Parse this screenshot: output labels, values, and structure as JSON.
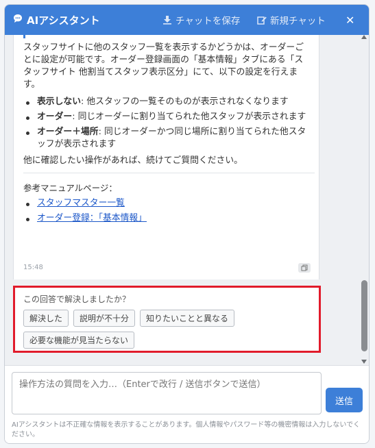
{
  "header": {
    "title": "AIアシスタント",
    "save_label": "チャットを保存",
    "new_chat_label": "新規チャット",
    "close_symbol": "✕"
  },
  "message": {
    "intro": "スタッフサイトに他のスタッフ一覧を表示するかどうかは、オーダーごとに設定が可能です。オーダー登録画面の「基本情報」タブにある「スタッフサイト 他割当てスタッフ表示区分」にて、以下の設定を行えます。",
    "bullets": [
      {
        "term": "表示しない",
        "desc": ": 他スタッフの一覧そのものが表示されなくなります"
      },
      {
        "term": "オーダー",
        "desc": ": 同じオーダーに割り当てられた他スタッフが表示されます"
      },
      {
        "term": "オーダー＋場所",
        "desc": ": 同じオーダーかつ同じ場所に割り当てられた他スタッフが表示されます"
      }
    ],
    "follow_up": "他に確認したい操作があれば、続けてご質問ください。",
    "refs_title": "参考マニュアルページ：",
    "refs": [
      "スタッフマスター一覧",
      "オーダー登録：「基本情報」"
    ],
    "timestamp": "15:48"
  },
  "feedback": {
    "question": "この回答で解決しましたか？",
    "options": [
      "解決した",
      "説明が不十分",
      "知りたいことと異なる",
      "必要な機能が見当たらない"
    ]
  },
  "input": {
    "placeholder": "操作方法の質問を入力…（Enterで改行 / 送信ボタンで送信）",
    "send_label": "送信",
    "disclaimer": "AIアシスタントは不正確な情報を表示することがあります。個人情報やパスワード等の機密情報は入力しないでください。"
  },
  "colors": {
    "accent": "#3d7fd8",
    "highlight_border": "#e11b2b"
  }
}
